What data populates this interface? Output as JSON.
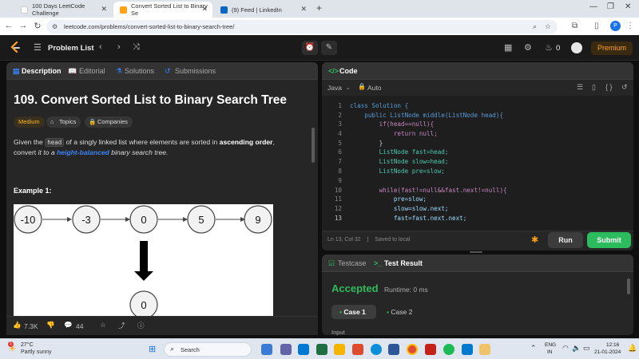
{
  "browser": {
    "tabs": [
      {
        "title": "100 Days LeetCode Challenge",
        "active": false
      },
      {
        "title": "Convert Sorted List to Binary Se",
        "active": true
      },
      {
        "title": "(9) Feed | LinkedIn",
        "active": false
      }
    ],
    "new_tab": "+",
    "url": "leetcode.com/problems/convert-sorted-list-to-binary-search-tree/",
    "profile_initial": "P"
  },
  "header": {
    "problem_list": "Problem List",
    "streak": "0",
    "premium": "Premium"
  },
  "problem": {
    "tabs": [
      "Description",
      "Editorial",
      "Solutions",
      "Submissions"
    ],
    "title": "109. Convert Sorted List to Binary Search Tree",
    "difficulty": "Medium",
    "topics": "Topics",
    "companies": "Companies",
    "desc_given": "Given the",
    "desc_code": "head",
    "desc_mid": "of a singly linked list where elements are sorted in",
    "desc_bold": "ascending order",
    "desc_comma": ",",
    "desc_convert": "convert",
    "desc_it": "it to a",
    "desc_link": "height-balanced",
    "desc_end": "binary search tree.",
    "example_title": "Example 1:",
    "list_nodes": [
      "-10",
      "-3",
      "0",
      "5",
      "9"
    ],
    "root_node": "0",
    "likes": "7.3K",
    "comments": "44"
  },
  "editor": {
    "title": "Code",
    "language": "Java",
    "mode": "Auto",
    "lines": [
      {
        "n": "1",
        "code": "class Solution {"
      },
      {
        "n": "2",
        "code": "    public ListNode middle(ListNode head){"
      },
      {
        "n": "3",
        "code": "        if(head==null){"
      },
      {
        "n": "4",
        "code": "            return null;"
      },
      {
        "n": "5",
        "code": "        }"
      },
      {
        "n": "6",
        "code": "        ListNode fast=head;"
      },
      {
        "n": "7",
        "code": "        ListNode slow=head;"
      },
      {
        "n": "8",
        "code": "        ListNode pre=slow;"
      },
      {
        "n": "9",
        "code": ""
      },
      {
        "n": "10",
        "code": "        while(fast!=null&&fast.next!=null){"
      },
      {
        "n": "11",
        "code": "            pre=slow;"
      },
      {
        "n": "12",
        "code": "            slow=slow.next;"
      },
      {
        "n": "13",
        "code": "            fast=fast.next.next;"
      }
    ],
    "cursor": "Ln 13, Col 32",
    "saved": "Saved to local",
    "run": "Run",
    "submit": "Submit"
  },
  "result": {
    "tabs": [
      "Testcase",
      "Test Result"
    ],
    "status": "Accepted",
    "runtime": "Runtime: 0 ms",
    "cases": [
      "Case 1",
      "Case 2"
    ],
    "input_label": "Input"
  },
  "taskbar": {
    "weather_temp": "27°C",
    "weather_desc": "Partly sunny",
    "search": "Search",
    "lang1": "ENG",
    "lang2": "IN",
    "time": "12:16",
    "date": "21-01-2024"
  },
  "colors": {
    "accent_green": "#2cbb5d",
    "premium_orange": "#ffa116",
    "medium_yellow": "#ffb800"
  }
}
